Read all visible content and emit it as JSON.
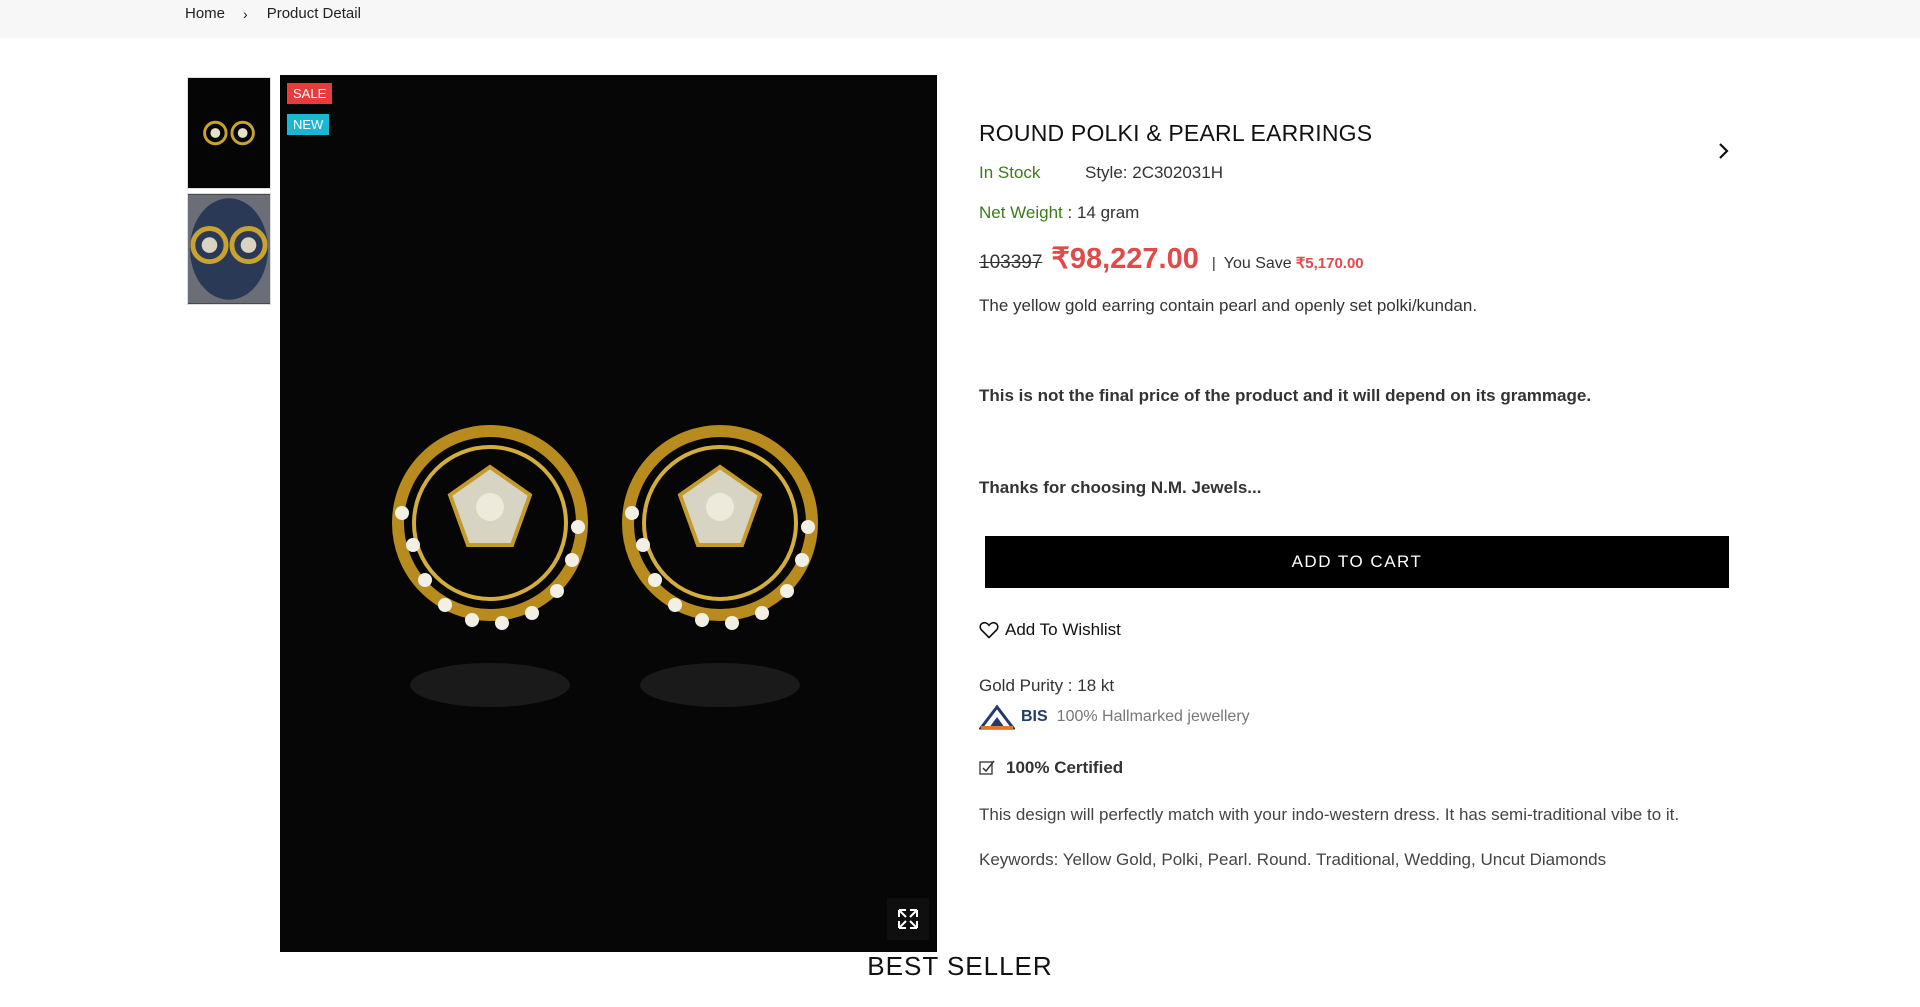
{
  "breadcrumb": {
    "home": "Home",
    "separator": "›",
    "current": "Product Detail"
  },
  "badges": {
    "sale": "SALE",
    "new": "NEW"
  },
  "product": {
    "title": "ROUND POLKI & PEARL EARRINGS",
    "stock": "In Stock",
    "style": "Style: 2C302031H",
    "weight_label": "Net Weight",
    "weight_value": " : 14 gram",
    "old_price": "103397",
    "price": "₹98,227.00",
    "pipe": "|",
    "save_label": "You Save",
    "save_amount": "₹5,170.00",
    "description": "The yellow gold earring contain pearl and openly set polki/kundan.",
    "note": "This is not the final price of the product and it will depend on its grammage.",
    "thanks": "Thanks for choosing N.M. Jewels...",
    "add_to_cart": "ADD TO CART",
    "wishlist": "Add To Wishlist",
    "purity": "Gold Purity : 18 kt",
    "bis": "BIS",
    "hallmark": "100% Hallmarked jewellery",
    "certified": "100% Certified",
    "design_note": "This design will perfectly match with your indo-western dress. It has semi-traditional vibe to it.",
    "keywords": "Keywords: Yellow Gold, Polki, Pearl. Round. Traditional, Wedding, Uncut Diamonds"
  },
  "section_title": "BEST SELLER",
  "colors": {
    "accent_red": "#e24a4a",
    "stock_green": "#3c7a1d",
    "badge_sale": "#e63c3c",
    "badge_new": "#19b7d6",
    "button_bg": "#000000"
  },
  "icons": [
    "chevron-right-icon",
    "expand-icon",
    "heart-icon",
    "checkbox-icon",
    "bis-logo-icon"
  ]
}
